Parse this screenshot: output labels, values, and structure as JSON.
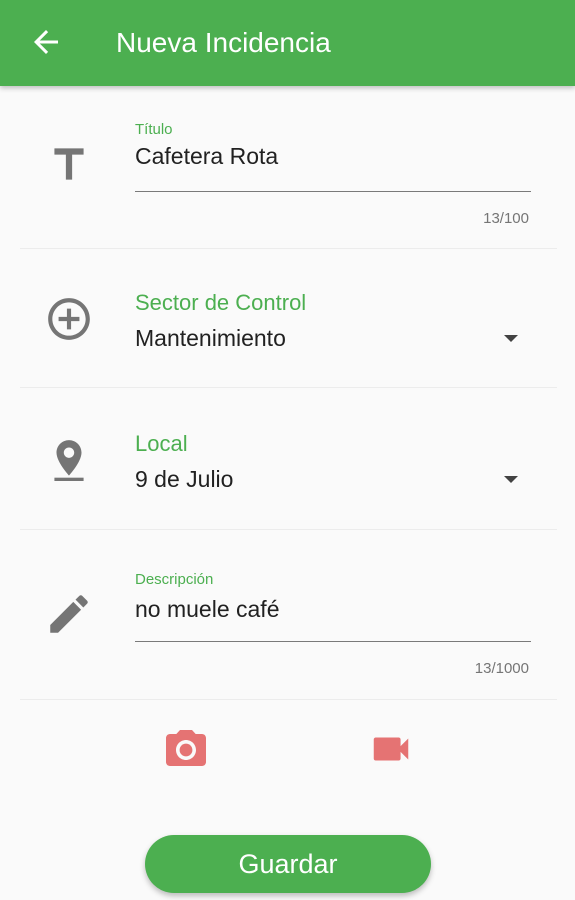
{
  "appbar": {
    "title": "Nueva Incidencia",
    "back_icon": "arrow-back-icon"
  },
  "form": {
    "titulo": {
      "icon": "text-title-icon",
      "label": "Título",
      "value": "Cafetera Rota",
      "counter": "13/100"
    },
    "sector": {
      "icon": "add-circle-icon",
      "label": "Sector de Control",
      "value": "Mantenimiento",
      "dropdown_icon": "arrow-drop-down-icon"
    },
    "local": {
      "icon": "location-pin-icon",
      "label": "Local",
      "value": "9 de Julio",
      "dropdown_icon": "arrow-drop-down-icon"
    },
    "descripcion": {
      "icon": "pencil-edit-icon",
      "label": "Descripción",
      "value": "no muele café",
      "counter": "13/1000"
    }
  },
  "media": {
    "camera_icon": "camera-icon",
    "video_icon": "videocam-icon",
    "icon_color": "#e57373"
  },
  "actions": {
    "save_label": "Guardar"
  },
  "colors": {
    "primary": "#4caf50",
    "icon_grey": "#757575",
    "background": "#fafafa"
  }
}
